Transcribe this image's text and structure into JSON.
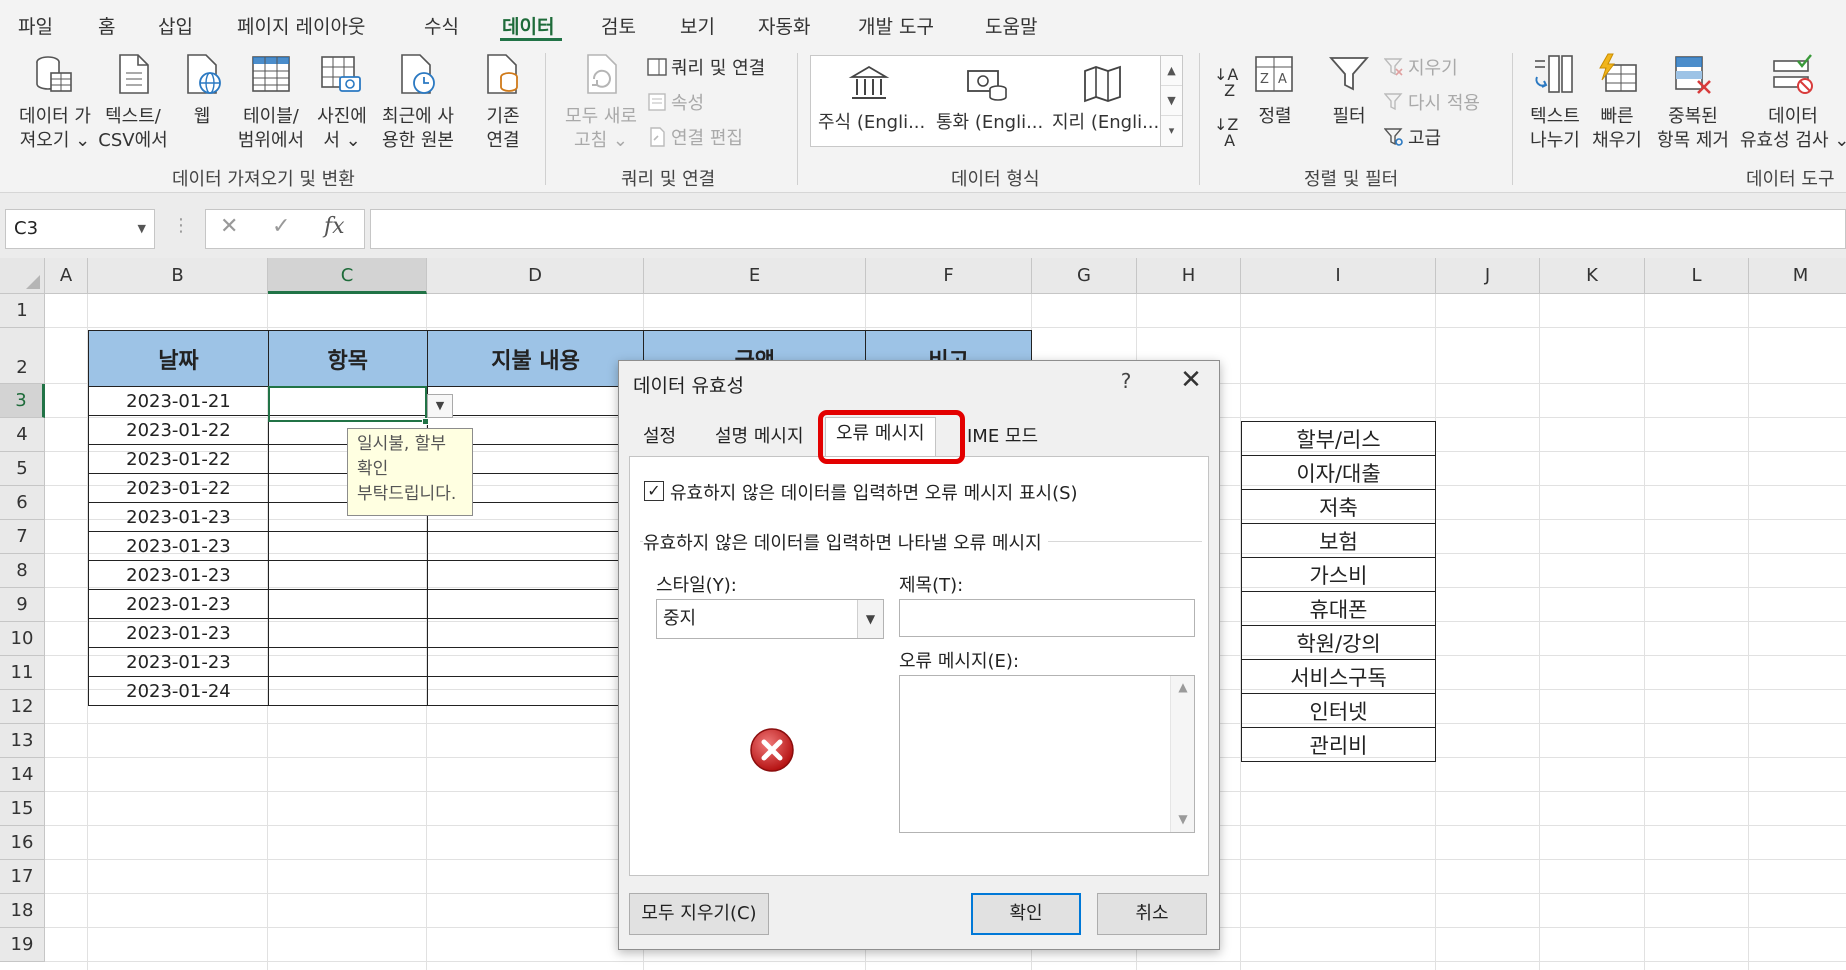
{
  "ribbon": {
    "tabs": [
      "파일",
      "홈",
      "삽입",
      "페이지 레이아웃",
      "수식",
      "데이터",
      "검토",
      "보기",
      "자동화",
      "개발 도구",
      "도움말"
    ],
    "active_tab": "데이터",
    "get_data": {
      "line1": "데이터 가",
      "line2": "져오기 ⌄"
    },
    "from_csv": {
      "line1": "텍스트/",
      "line2": "CSV에서"
    },
    "from_web": {
      "line1": "웹"
    },
    "from_table": {
      "line1": "테이블/",
      "line2": "범위에서"
    },
    "from_picture": {
      "line1": "사진에",
      "line2": "서 ⌄"
    },
    "recent_sources": {
      "line1": "최근에 사",
      "line2": "용한 원본"
    },
    "existing_connections": {
      "line1": "기존",
      "line2": "연결"
    },
    "refresh_all": {
      "line1": "모두 새로",
      "line2": "고침 ⌄"
    },
    "queries_connections": "쿼리 및 연결",
    "properties": "속성",
    "edit_links": "연결 편집",
    "stocks": "주식 (Engli...",
    "currencies": "통화 (Engli...",
    "geography": "지리 (Engli...",
    "sort": "정렬",
    "filter": "필터",
    "clear": "지우기",
    "reapply": "다시 적용",
    "advanced": "고급",
    "text_to_columns": {
      "line1": "텍스트",
      "line2": "나누기"
    },
    "flash_fill": {
      "line1": "빠른",
      "line2": "채우기"
    },
    "remove_duplicates": {
      "line1": "중복된",
      "line2": "항목 제거"
    },
    "data_validation": {
      "line1": "데이터",
      "line2": "유효성 검사 ⌄"
    },
    "groups": [
      "데이터 가져오기 및 변환",
      "쿼리 및 연결",
      "데이터 형식",
      "정렬 및 필터",
      "데이터 도구"
    ]
  },
  "formula_bar": {
    "name_box": "C3",
    "cancel": "✕",
    "enter": "✓",
    "fx": "fx",
    "formula": ""
  },
  "sheet": {
    "columns": [
      "A",
      "B",
      "C",
      "D",
      "E",
      "F",
      "G",
      "H",
      "I",
      "J",
      "K",
      "L",
      "M"
    ],
    "selected_column": "C",
    "rows": [
      "1",
      "2",
      "3",
      "4",
      "5",
      "6",
      "7",
      "8",
      "9",
      "10",
      "11",
      "12",
      "13",
      "14",
      "15",
      "16",
      "17",
      "18",
      "19"
    ],
    "selected_row": "3",
    "table_headers": [
      "날짜",
      "항목",
      "지불 내용",
      "금액",
      "비고"
    ],
    "dates": [
      "2023-01-21",
      "2023-01-22",
      "2023-01-22",
      "2023-01-22",
      "2023-01-23",
      "2023-01-23",
      "2023-01-23",
      "2023-01-23",
      "2023-01-23",
      "2023-01-23",
      "2023-01-24"
    ],
    "side_list": [
      "할부/리스",
      "이자/대출",
      "저축",
      "보험",
      "가스비",
      "휴대폰",
      "학원/강의",
      "서비스구독",
      "인터넷",
      "관리비"
    ],
    "tooltip": {
      "line1": "일시불, 할부",
      "line2": "확인",
      "line3": "부탁드립니다."
    }
  },
  "dialog": {
    "title": "데이터 유효성",
    "help": "?",
    "close": "✕",
    "tabs": [
      "설정",
      "설명 메시지",
      "오류 메시지",
      "IME 모드"
    ],
    "active_tab": "오류 메시지",
    "show_error_checkbox": "유효하지 않은 데이터를 입력하면 오류 메시지 표시(S)",
    "checked": true,
    "section_label": "유효하지 않은 데이터를 입력하면 나타낼 오류 메시지",
    "style_label": "스타일(Y):",
    "style_value": "중지",
    "title_label": "제목(T):",
    "title_value": "",
    "message_label": "오류 메시지(E):",
    "message_value": "",
    "clear_all": "모두 지우기(C)",
    "ok": "확인",
    "cancel": "취소"
  },
  "colors": {
    "accent": "#217346",
    "header_fill": "#9dc3e6",
    "highlight": "#e30000",
    "tooltip_bg": "#ffffe1"
  }
}
